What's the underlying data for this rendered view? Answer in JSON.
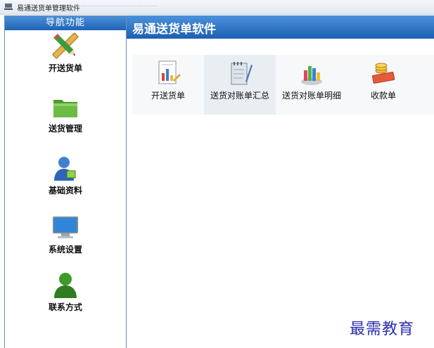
{
  "window": {
    "title": "易通送货单管理软件",
    "ghost_text": "————————————"
  },
  "sidebar": {
    "header": "导航功能",
    "items": [
      {
        "label": "开送货单",
        "icon": "pencil-ruler-icon"
      },
      {
        "label": "送货管理",
        "icon": "folder-icon"
      },
      {
        "label": "基础资料",
        "icon": "user-icon"
      },
      {
        "label": "系统设置",
        "icon": "monitor-icon"
      },
      {
        "label": "联系方式",
        "icon": "contact-person-icon"
      }
    ]
  },
  "main": {
    "banner_title": "易通送货单软件",
    "toolbar": [
      {
        "label": "开送货单",
        "icon": "report-icon"
      },
      {
        "label": "送货对账单汇总",
        "icon": "notebook-pen-icon"
      },
      {
        "label": "送货对账单明细",
        "icon": "bar-chart-icon"
      },
      {
        "label": "收款单",
        "icon": "coins-book-icon"
      }
    ]
  },
  "watermark": "最需教育",
  "colors": {
    "header_blue": "#1f64b5",
    "border": "#6f8fb3",
    "watermark": "#2b2fb0"
  }
}
